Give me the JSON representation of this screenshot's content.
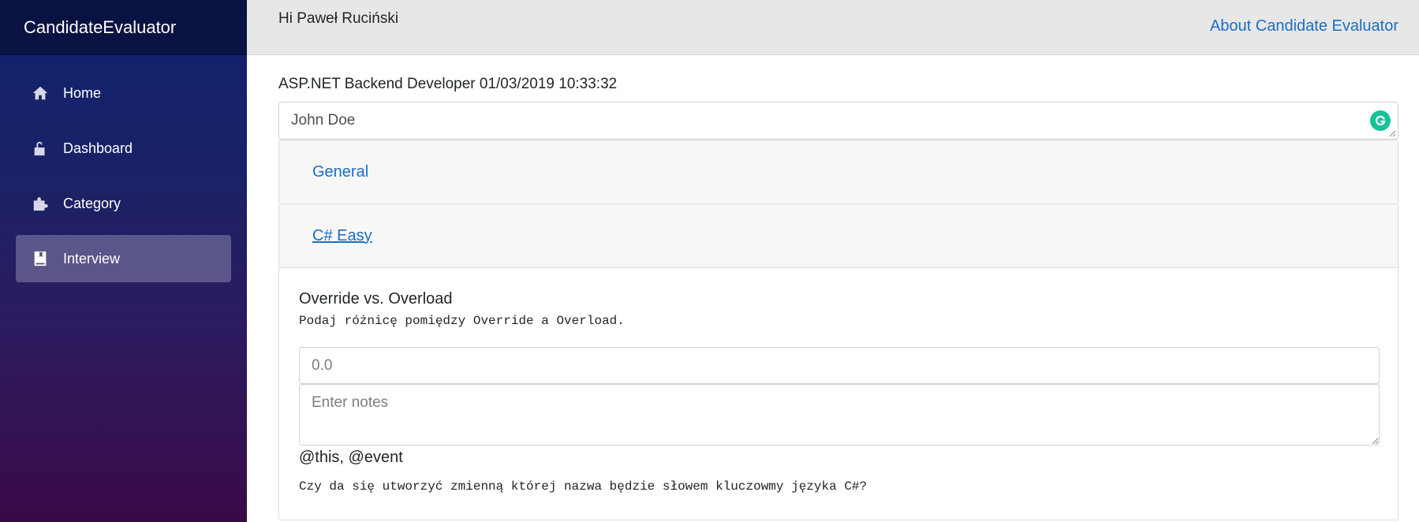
{
  "app": {
    "brand": "CandidateEvaluator"
  },
  "sidebar": {
    "items": [
      {
        "label": "Home",
        "icon": "home-icon",
        "active": false
      },
      {
        "label": "Dashboard",
        "icon": "lock-open-icon",
        "active": false
      },
      {
        "label": "Category",
        "icon": "puzzle-icon",
        "active": false
      },
      {
        "label": "Interview",
        "icon": "book-icon",
        "active": true
      }
    ]
  },
  "header": {
    "greeting": "Hi Paweł Ruciński",
    "about_link": "About Candidate Evaluator"
  },
  "interview": {
    "title": "ASP.NET Backend Developer 01/03/2019 10:33:32",
    "candidate_name": "John Doe"
  },
  "categories": [
    {
      "label": "General"
    },
    {
      "label": "C# Easy"
    }
  ],
  "questions": [
    {
      "title": "Override vs. Overload",
      "description": "Podaj różnicę pomiędzy Override a Overload.",
      "score_placeholder": "0.0",
      "notes_placeholder": "Enter notes"
    },
    {
      "title": "@this, @event",
      "description": "Czy da się utworzyć zmienną której nazwa będzie słowem kluczowmy języka C#?"
    }
  ],
  "colors": {
    "link": "#1b6ec2",
    "sidebar_top": "#0f2170",
    "sidebar_bottom": "#3a0a47",
    "grammarly": "#15c39a"
  }
}
